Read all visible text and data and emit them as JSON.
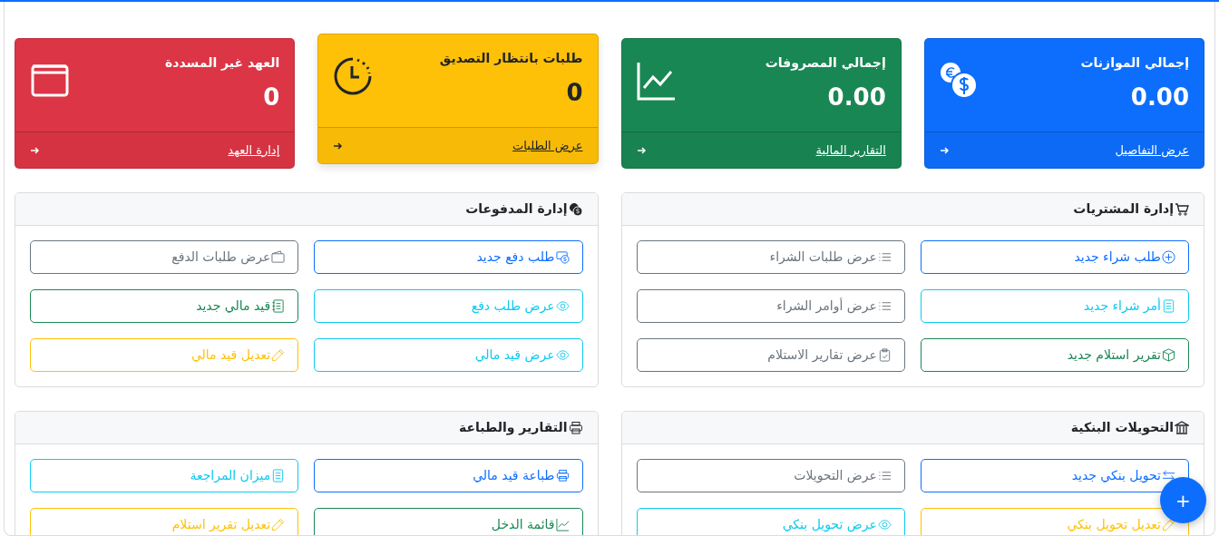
{
  "stat_cards": [
    {
      "kind": "primary",
      "title": "إجمالي الموازنات",
      "value": "0.00",
      "link": "عرض التفاصيل",
      "raised": false
    },
    {
      "kind": "success",
      "title": "إجمالي المصروفات",
      "value": "0.00",
      "link": "التقارير المالية",
      "raised": false
    },
    {
      "kind": "warning",
      "title": "طلبات بانتظار التصديق",
      "value": "0",
      "link": "عرض الطلبات",
      "raised": true
    },
    {
      "kind": "danger",
      "title": "العهد غير المسددة",
      "value": "0",
      "link": "إدارة العهد",
      "raised": false
    }
  ],
  "panels": [
    {
      "title": "إدارة المشتريات",
      "buttons": [
        {
          "kind": "primary",
          "label": "طلب شراء جديد"
        },
        {
          "kind": "secondary",
          "label": "عرض طلبات الشراء"
        },
        {
          "kind": "info",
          "label": "أمر شراء جديد"
        },
        {
          "kind": "secondary",
          "label": "عرض أوامر الشراء"
        },
        {
          "kind": "success",
          "label": "تقرير استلام جديد"
        },
        {
          "kind": "secondary",
          "label": "عرض تقارير الاستلام"
        }
      ]
    },
    {
      "title": "إدارة المدفوعات",
      "buttons": [
        {
          "kind": "primary",
          "label": "طلب دفع جديد"
        },
        {
          "kind": "secondary",
          "label": "عرض طلبات الدفع"
        },
        {
          "kind": "info",
          "label": "عرض طلب دفع"
        },
        {
          "kind": "success",
          "label": "قيد مالي جديد"
        },
        {
          "kind": "info",
          "label": "عرض قيد مالي"
        },
        {
          "kind": "warning",
          "label": "تعديل قيد مالي"
        }
      ]
    },
    {
      "title": "التحويلات البنكية",
      "buttons": [
        {
          "kind": "primary",
          "label": "تحويل بنكي جديد"
        },
        {
          "kind": "secondary",
          "label": "عرض التحويلات"
        },
        {
          "kind": "warning",
          "label": "تعديل تحويل بنكي"
        },
        {
          "kind": "info",
          "label": "عرض تحويل بنكي"
        }
      ]
    },
    {
      "title": "التقارير والطباعة",
      "buttons": [
        {
          "kind": "primary",
          "label": "طباعة قيد مالي"
        },
        {
          "kind": "info",
          "label": "ميزان المراجعة"
        },
        {
          "kind": "success",
          "label": "قائمة الدخل"
        },
        {
          "kind": "warning",
          "label": "تعديل تقرير استلام"
        }
      ]
    }
  ],
  "fab": {
    "label": "+"
  }
}
